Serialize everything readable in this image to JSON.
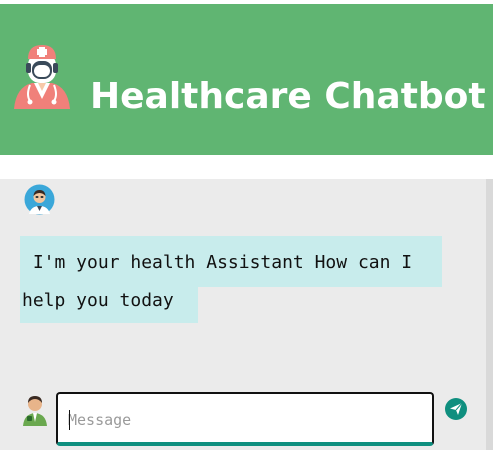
{
  "header": {
    "title": "Healthcare Chatbot",
    "logo_icon": "doctor-icon",
    "background": "#60b572"
  },
  "chat": {
    "bot_avatar_icon": "doctor-avatar-icon",
    "messages": [
      {
        "sender": "bot",
        "line1": " I'm your health Assistant How can I",
        "line2": "help you today"
      }
    ],
    "bubble_color": "#c8ecec",
    "area_background": "#ebebeb"
  },
  "composer": {
    "user_avatar_icon": "user-avatar-icon",
    "placeholder": "Message",
    "value": "",
    "send_icon": "send-icon",
    "accent": "#0f8f7f"
  }
}
